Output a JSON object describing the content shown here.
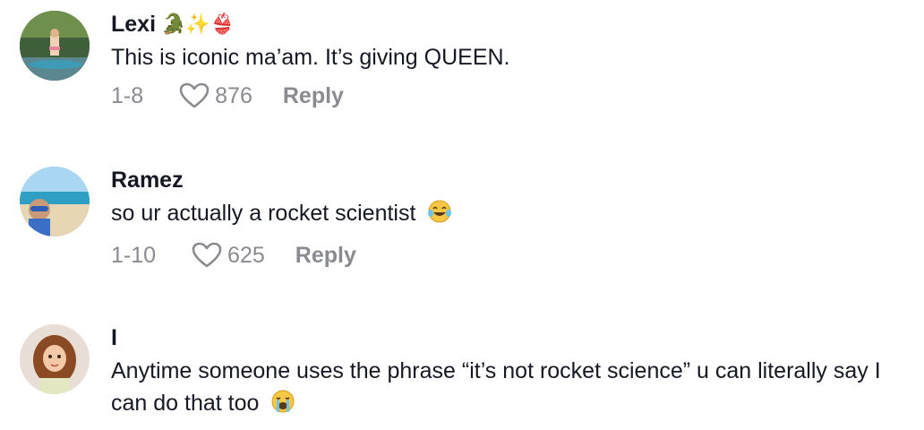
{
  "comments": [
    {
      "username": "Lexi",
      "username_emojis": "🐊✨👙",
      "text": "This is iconic ma’am. It’s giving QUEEN.",
      "date": "1-8",
      "likes": "876",
      "reply_label": "Reply",
      "icon": "heart-outline-icon"
    },
    {
      "username": "Ramez",
      "text": "so ur actually a rocket scientist",
      "text_emoji": "laughing-tears-emoji",
      "date": "1-10",
      "likes": "625",
      "reply_label": "Reply",
      "icon": "heart-outline-icon"
    },
    {
      "username": "I",
      "text": "Anytime someone uses the phrase “it’s not rocket science” u can literally say I can do that too",
      "text_emoji": "crying-emoji"
    }
  ],
  "colors": {
    "text": "#161823",
    "secondary": "#8a8b91",
    "background": "#ffffff"
  }
}
